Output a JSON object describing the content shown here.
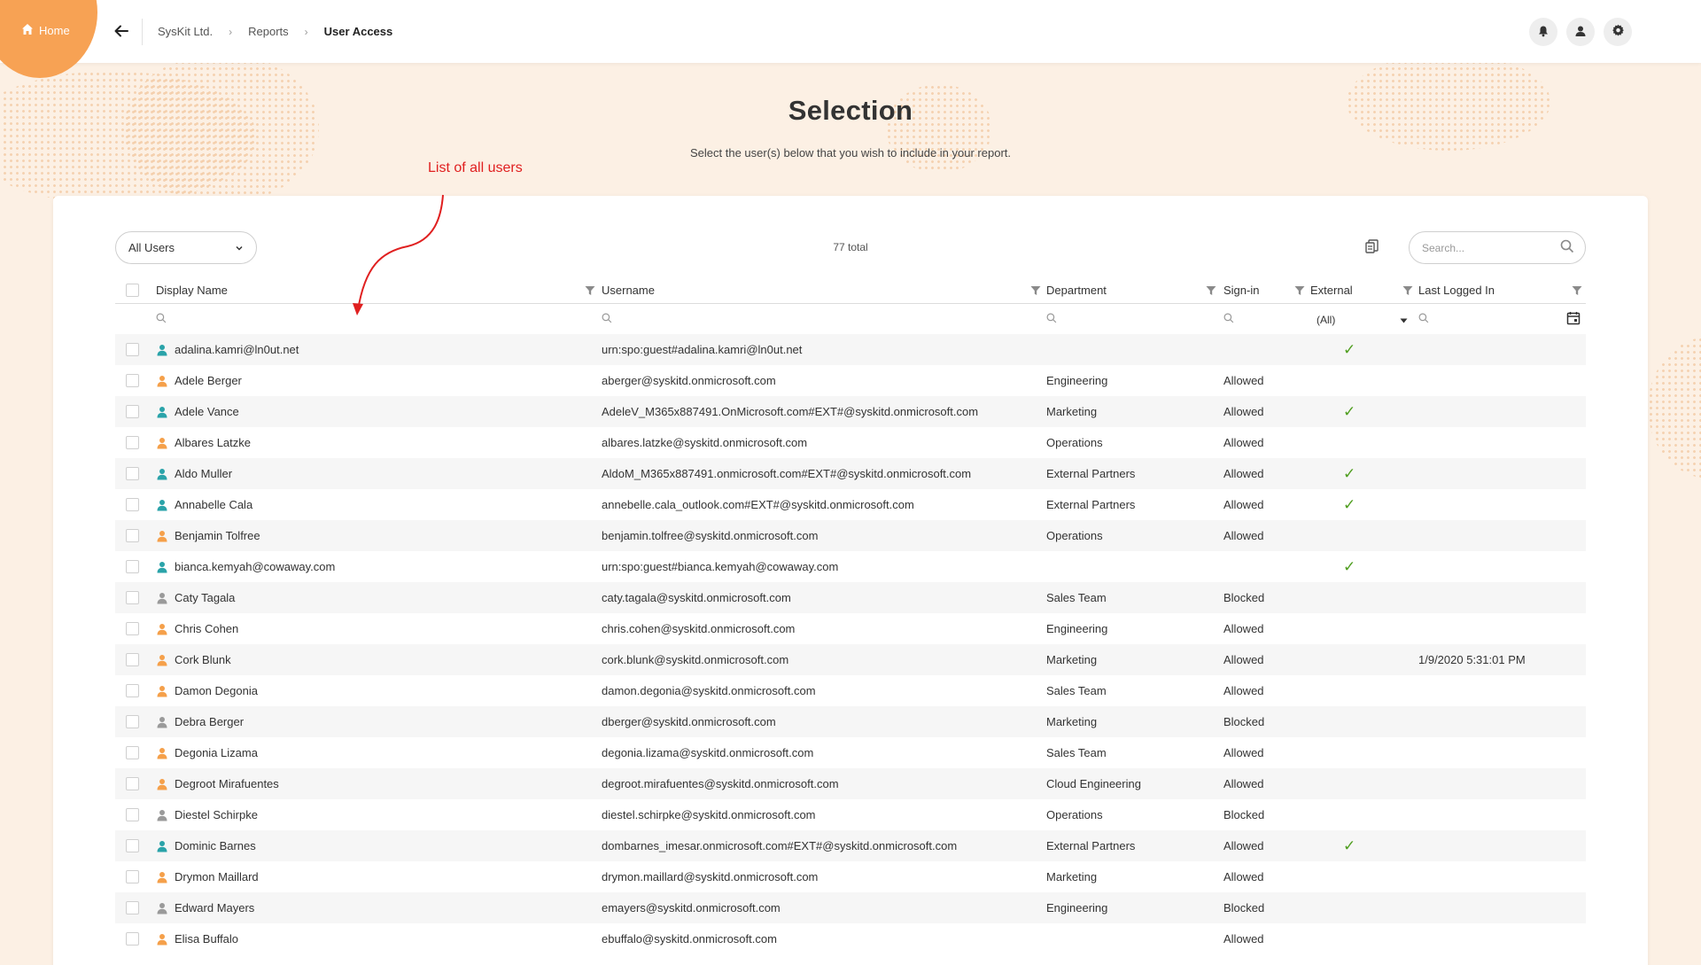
{
  "topbar": {
    "home_label": "Home",
    "breadcrumb": [
      "SysKit Ltd.",
      "Reports",
      "User Access"
    ]
  },
  "heading": {
    "title": "Selection",
    "subtitle": "Select the user(s) below that you wish to include in your report."
  },
  "annotation": "List of all users",
  "toolbar": {
    "scope_value": "All Users",
    "total": "77 total",
    "search_placeholder": "Search..."
  },
  "columns": [
    "Display Name",
    "Username",
    "Department",
    "Sign-in",
    "External",
    "Last Logged In"
  ],
  "external_filter_value": "(All)",
  "colors": {
    "accent_orange": "#f7a254",
    "icon_external": "#2aa3a9",
    "icon_member": "#f5a04a",
    "icon_blocked": "#9a9a9a",
    "check_green": "#4f9e1f"
  },
  "rows": [
    {
      "name": "adalina.kamri@ln0ut.net",
      "username": "urn:spo:guest#adalina.kamri@ln0ut.net",
      "department": "",
      "signin": "",
      "external": "✓",
      "last": "",
      "icon": "guest"
    },
    {
      "name": "Adele Berger",
      "username": "aberger@syskitd.onmicrosoft.com",
      "department": "Engineering",
      "signin": "Allowed",
      "external": "",
      "last": "",
      "icon": "member"
    },
    {
      "name": "Adele Vance",
      "username": "AdeleV_M365x887491.OnMicrosoft.com#EXT#@syskitd.onmicrosoft.com",
      "department": "Marketing",
      "signin": "Allowed",
      "external": "✓",
      "last": "",
      "icon": "guest"
    },
    {
      "name": "Albares Latzke",
      "username": "albares.latzke@syskitd.onmicrosoft.com",
      "department": "Operations",
      "signin": "Allowed",
      "external": "",
      "last": "",
      "icon": "member"
    },
    {
      "name": "Aldo Muller",
      "username": "AldoM_M365x887491.onmicrosoft.com#EXT#@syskitd.onmicrosoft.com",
      "department": "External Partners",
      "signin": "Allowed",
      "external": "✓",
      "last": "",
      "icon": "guest"
    },
    {
      "name": "Annabelle Cala",
      "username": "annebelle.cala_outlook.com#EXT#@syskitd.onmicrosoft.com",
      "department": "External Partners",
      "signin": "Allowed",
      "external": "✓",
      "last": "",
      "icon": "guest"
    },
    {
      "name": "Benjamin Tolfree",
      "username": "benjamin.tolfree@syskitd.onmicrosoft.com",
      "department": "Operations",
      "signin": "Allowed",
      "external": "",
      "last": "",
      "icon": "member"
    },
    {
      "name": "bianca.kemyah@cowaway.com",
      "username": "urn:spo:guest#bianca.kemyah@cowaway.com",
      "department": "",
      "signin": "",
      "external": "✓",
      "last": "",
      "icon": "guest"
    },
    {
      "name": "Caty Tagala",
      "username": "caty.tagala@syskitd.onmicrosoft.com",
      "department": "Sales Team",
      "signin": "Blocked",
      "external": "",
      "last": "",
      "icon": "blocked"
    },
    {
      "name": "Chris Cohen",
      "username": "chris.cohen@syskitd.onmicrosoft.com",
      "department": "Engineering",
      "signin": "Allowed",
      "external": "",
      "last": "",
      "icon": "member"
    },
    {
      "name": "Cork Blunk",
      "username": "cork.blunk@syskitd.onmicrosoft.com",
      "department": "Marketing",
      "signin": "Allowed",
      "external": "",
      "last": "1/9/2020 5:31:01 PM",
      "icon": "member"
    },
    {
      "name": "Damon Degonia",
      "username": "damon.degonia@syskitd.onmicrosoft.com",
      "department": "Sales Team",
      "signin": "Allowed",
      "external": "",
      "last": "",
      "icon": "member"
    },
    {
      "name": "Debra Berger",
      "username": "dberger@syskitd.onmicrosoft.com",
      "department": "Marketing",
      "signin": "Blocked",
      "external": "",
      "last": "",
      "icon": "blocked"
    },
    {
      "name": "Degonia Lizama",
      "username": "degonia.lizama@syskitd.onmicrosoft.com",
      "department": "Sales Team",
      "signin": "Allowed",
      "external": "",
      "last": "",
      "icon": "member"
    },
    {
      "name": "Degroot Mirafuentes",
      "username": "degroot.mirafuentes@syskitd.onmicrosoft.com",
      "department": "Cloud Engineering",
      "signin": "Allowed",
      "external": "",
      "last": "",
      "icon": "member"
    },
    {
      "name": "Diestel Schirpke",
      "username": "diestel.schirpke@syskitd.onmicrosoft.com",
      "department": "Operations",
      "signin": "Blocked",
      "external": "",
      "last": "",
      "icon": "blocked"
    },
    {
      "name": "Dominic Barnes",
      "username": "dombarnes_imesar.onmicrosoft.com#EXT#@syskitd.onmicrosoft.com",
      "department": "External Partners",
      "signin": "Allowed",
      "external": "✓",
      "last": "",
      "icon": "guest"
    },
    {
      "name": "Drymon Maillard",
      "username": "drymon.maillard@syskitd.onmicrosoft.com",
      "department": "Marketing",
      "signin": "Allowed",
      "external": "",
      "last": "",
      "icon": "member"
    },
    {
      "name": "Edward Mayers",
      "username": "emayers@syskitd.onmicrosoft.com",
      "department": "Engineering",
      "signin": "Blocked",
      "external": "",
      "last": "",
      "icon": "blocked"
    },
    {
      "name": "Elisa Buffalo",
      "username": "ebuffalo@syskitd.onmicrosoft.com",
      "department": "",
      "signin": "Allowed",
      "external": "",
      "last": "",
      "icon": "member"
    }
  ]
}
